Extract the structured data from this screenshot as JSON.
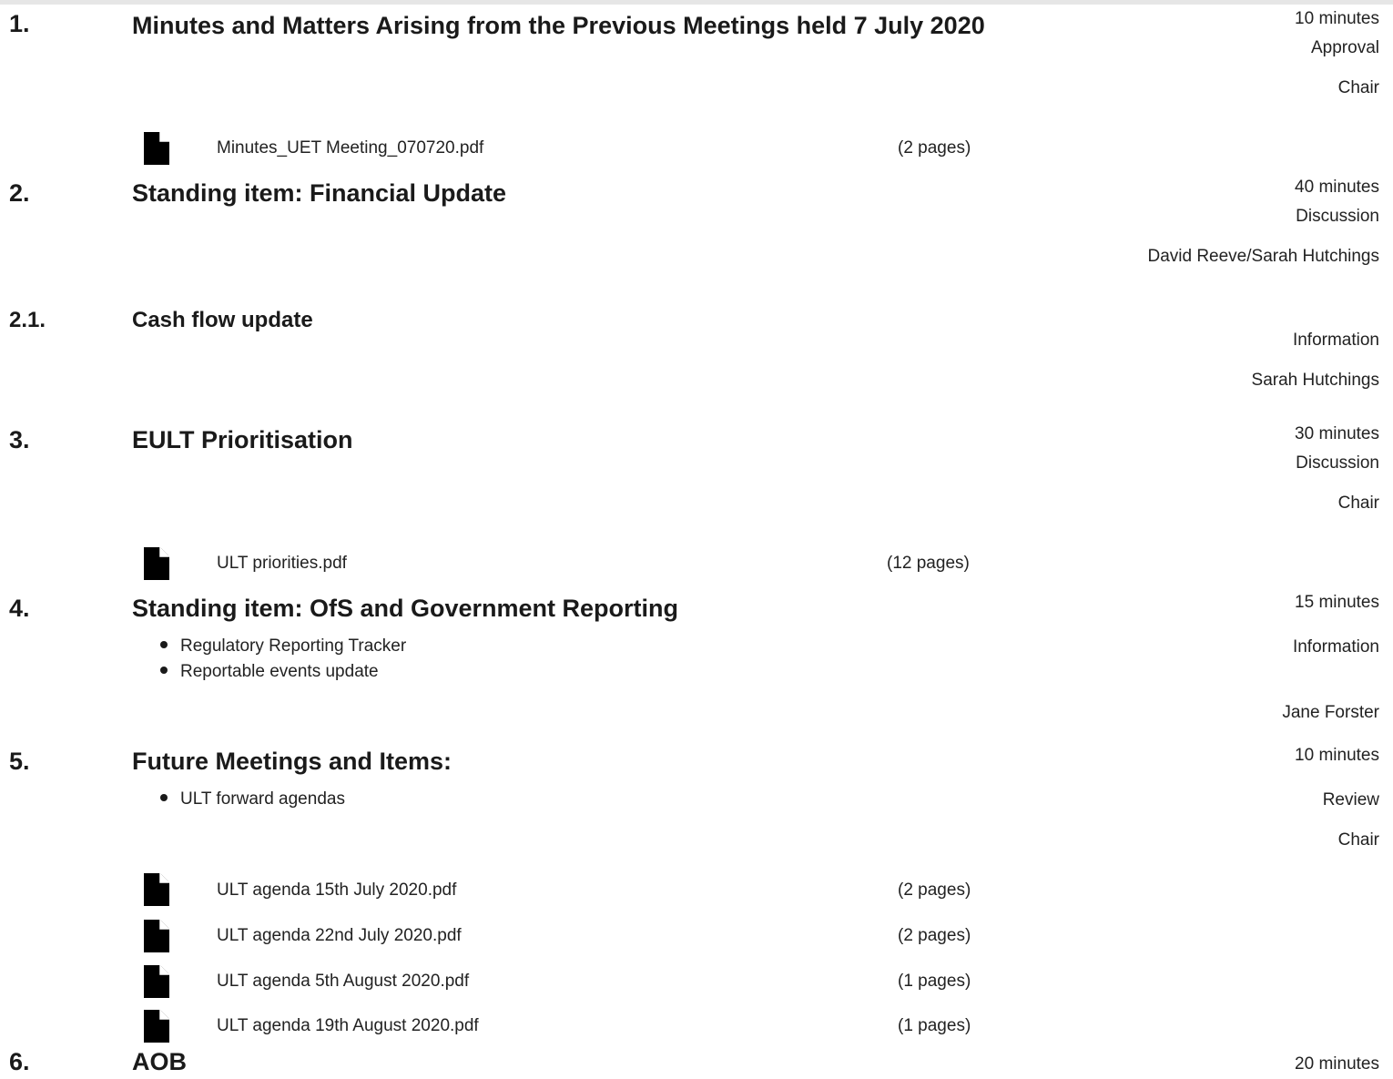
{
  "items": [
    {
      "number": "1.",
      "title": "Minutes and Matters Arising from the Previous Meetings held 7 July 2020",
      "duration": "10 minutes",
      "type": "Approval",
      "presenter": "Chair",
      "documents": [
        {
          "icon": "document-icon",
          "name": "Minutes_UET Meeting_070720.pdf",
          "pages": "(2 pages)"
        }
      ]
    },
    {
      "number": "2.",
      "title": "Standing item: Financial Update",
      "duration": "40 minutes",
      "type": "Discussion",
      "presenter": "David Reeve/Sarah Hutchings"
    },
    {
      "number": "2.1.",
      "title": "Cash flow update",
      "type": "Information",
      "presenter": "Sarah Hutchings"
    },
    {
      "number": "3.",
      "title": "EULT Prioritisation",
      "duration": "30 minutes",
      "type": "Discussion",
      "presenter": "Chair",
      "documents": [
        {
          "icon": "document-icon",
          "name": "ULT priorities.pdf",
          "pages": "(12 pages)"
        }
      ]
    },
    {
      "number": "4.",
      "title": "Standing item: OfS and Government Reporting",
      "duration": "15 minutes",
      "type": "Information",
      "presenter": "Jane Forster",
      "bullets": [
        "Regulatory Reporting Tracker",
        "Reportable events update"
      ]
    },
    {
      "number": "5.",
      "title": "Future Meetings and Items:",
      "duration": "10 minutes",
      "type": "Review",
      "presenter": "Chair",
      "bullets": [
        "ULT forward agendas"
      ],
      "documents": [
        {
          "icon": "document-icon",
          "name": "ULT agenda 15th July 2020.pdf",
          "pages": "(2 pages)"
        },
        {
          "icon": "document-icon",
          "name": "ULT agenda 22nd July 2020.pdf",
          "pages": "(2 pages)"
        },
        {
          "icon": "document-icon",
          "name": "ULT agenda 5th August 2020.pdf",
          "pages": "(1 pages)"
        },
        {
          "icon": "document-icon",
          "name": "ULT agenda 19th August 2020.pdf",
          "pages": "(1 pages)"
        }
      ]
    },
    {
      "number": "6.",
      "title": "AOB",
      "duration": "20 minutes"
    }
  ]
}
